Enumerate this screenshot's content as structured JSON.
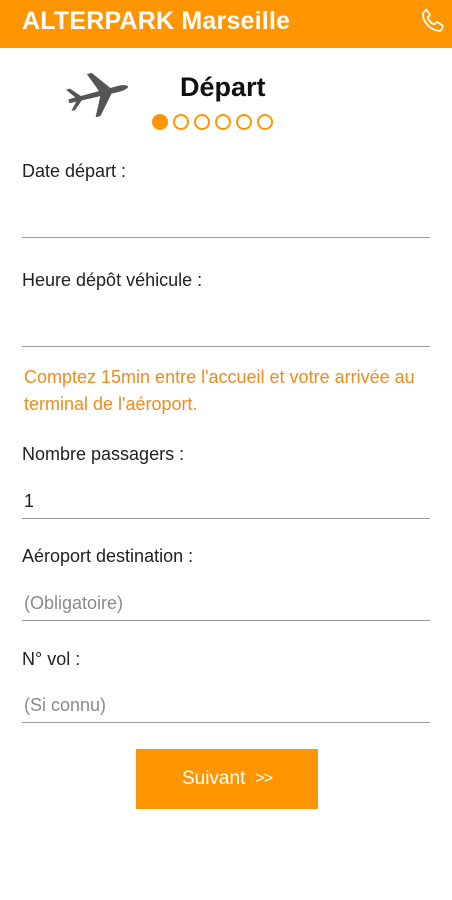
{
  "header": {
    "title": "ALTERPARK Marseille",
    "phone_icon": "phone-icon",
    "color": "#ff9500"
  },
  "step": {
    "title": "Départ",
    "icon": "plane-icon",
    "current": 1,
    "total": 6
  },
  "form": {
    "date_label": "Date départ :",
    "date_value": "",
    "time_label": "Heure dépôt véhicule :",
    "time_value": "",
    "notice": "Comptez 15min entre l'accueil et votre arrivée au terminal de l'aéroport.",
    "passengers_label": "Nombre passagers :",
    "passengers_value": "1",
    "airport_label": "Aéroport destination :",
    "airport_placeholder": "(Obligatoire)",
    "flight_label": "N° vol :",
    "flight_placeholder": "(Si connu)"
  },
  "next_button": {
    "label": "Suivant",
    "arrows": ">>"
  }
}
